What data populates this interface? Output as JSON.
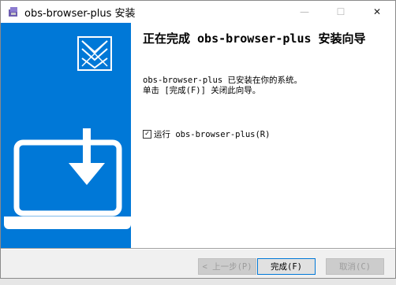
{
  "window": {
    "title": "obs-browser-plus 安装",
    "min_label": "—",
    "max_label": "☐",
    "close_label": "✕"
  },
  "content": {
    "heading": "正在完成 obs-browser-plus 安装向导",
    "desc_line1": "obs-browser-plus 已安装在你的系统。",
    "desc_line2": "单击 [完成(F)] 关闭此向导。",
    "run_checkbox": {
      "label": "运行 obs-browser-plus(R)",
      "checked": true,
      "check_glyph": "✓"
    }
  },
  "buttons": {
    "back": "< 上一步(P)",
    "finish": "完成(F)",
    "cancel": "取消(C)"
  },
  "colors": {
    "banner": "#0078d7",
    "banner_art": "#ffffff"
  }
}
